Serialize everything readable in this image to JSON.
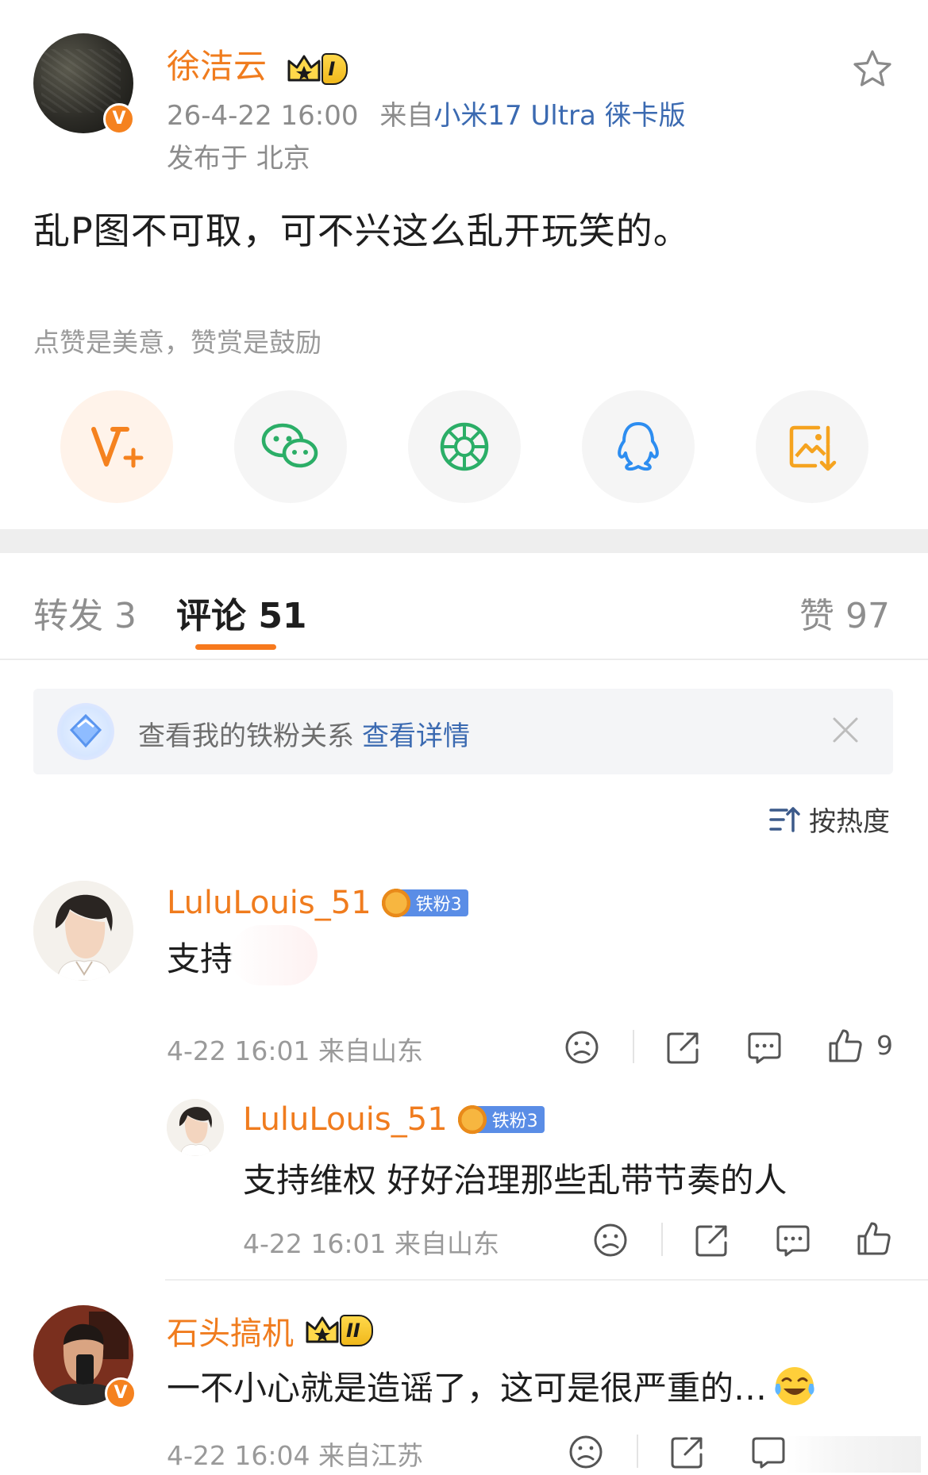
{
  "post": {
    "author": "徐洁云",
    "level": "I",
    "time": "26-4-22 16:00",
    "from_prefix": "来自",
    "source": "小米17 Ultra 徕卡版",
    "location": "发布于 北京",
    "text": "乱P图不可取，可不兴这么乱开玩笑的。",
    "reward_hint": "点赞是美意，赞赏是鼓励",
    "verified_badge": "V"
  },
  "share_icons": [
    "v-plus-icon",
    "wechat-icon",
    "moments-icon",
    "qq-icon",
    "save-image-icon"
  ],
  "tabs": {
    "repost": "转发 3",
    "comment": "评论 51",
    "like": "赞 97"
  },
  "fan_banner": {
    "text": "查看我的铁粉关系",
    "link": "查看详情"
  },
  "sort": {
    "label": "按热度"
  },
  "comments": [
    {
      "user": "LuluLouis_51",
      "badge": "铁粉3",
      "text": "支持",
      "meta": "4-22 16:01 来自山东",
      "likes": "9",
      "replies": [
        {
          "user": "LuluLouis_51",
          "badge": "铁粉3",
          "text": "支持维权 好好治理那些乱带节奏的人",
          "meta": "4-22 16:01 来自山东"
        }
      ]
    },
    {
      "user": "石头搞机",
      "level": "II",
      "text": "一不小心就是造谣了，这可是很严重的…",
      "meta": "4-22 16:04 来自江苏"
    }
  ],
  "colors": {
    "accent_orange": "#f07c1e",
    "link_blue": "#3b6ab1",
    "fan_blue": "#5a8de6",
    "tab_underline": "#f7791d"
  }
}
